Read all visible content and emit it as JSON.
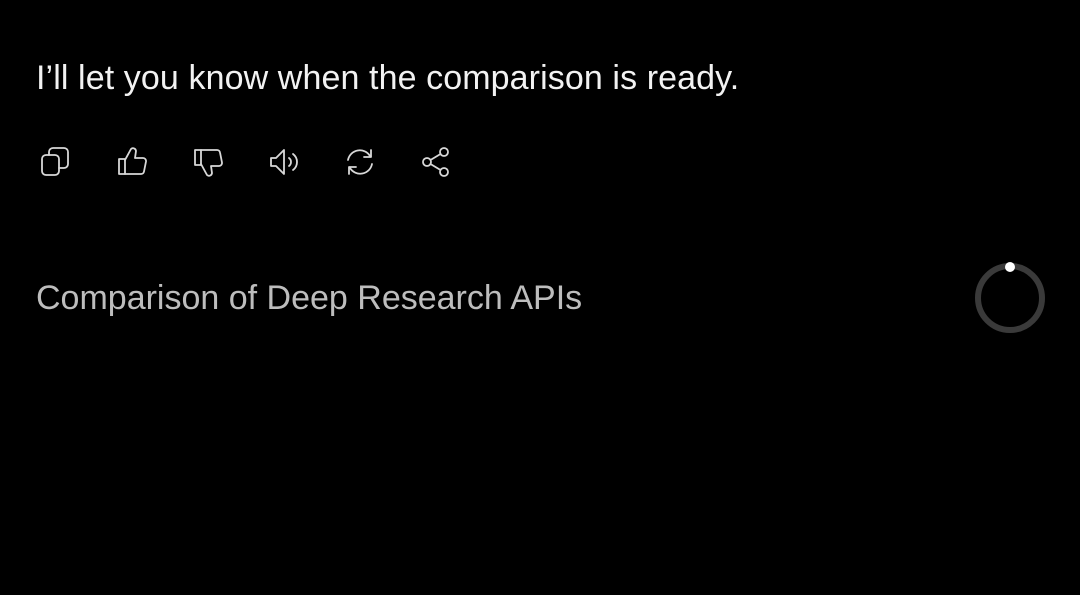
{
  "message": {
    "text": "I’ll let you know when the comparison is ready."
  },
  "actions": {
    "copy_icon": "copy-icon",
    "like_icon": "thumbs-up-icon",
    "dislike_icon": "thumbs-down-icon",
    "read_aloud_icon": "speaker-icon",
    "regenerate_icon": "refresh-icon",
    "share_icon": "share-icon"
  },
  "task": {
    "title": "Comparison of Deep Research APIs",
    "status_icon": "loading-spinner-icon"
  },
  "colors": {
    "background": "#000000",
    "message_text": "#f2f2f2",
    "task_text": "#bdbdbd",
    "icon_stroke": "#d8d8d8",
    "spinner_track": "#3a3a3a",
    "spinner_dot": "#ffffff"
  }
}
